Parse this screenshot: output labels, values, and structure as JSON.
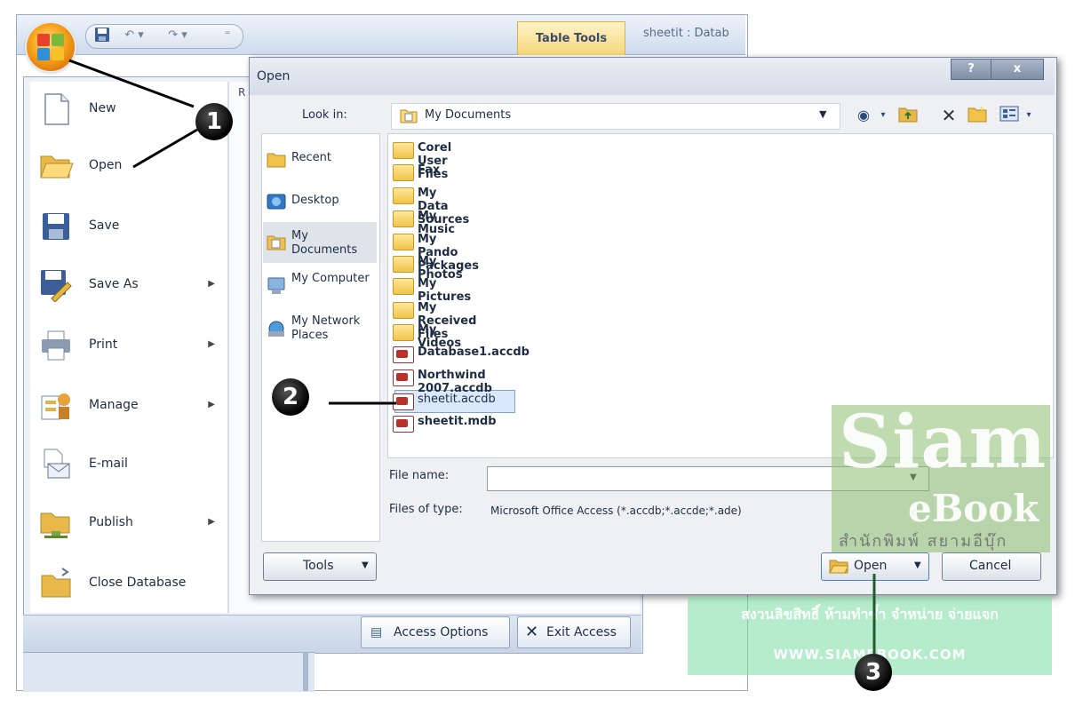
{
  "app": {
    "table_tools": "Table Tools",
    "title": "sheetit : Datab",
    "colors": {
      "ribbon": "#dbe5f2",
      "office_orange": "#f7a21a",
      "selection": "#dbe8fb"
    }
  },
  "qat": {
    "icons": [
      "save-icon",
      "undo-icon",
      "redo-icon",
      "customize-icon"
    ]
  },
  "menu": {
    "recent_header": "R",
    "items": [
      {
        "label": "New",
        "icon": "new-document-icon",
        "submenu": false
      },
      {
        "label": "Open",
        "icon": "open-folder-icon",
        "submenu": false
      },
      {
        "label": "Save",
        "icon": "save-disk-icon",
        "submenu": false
      },
      {
        "label": "Save As",
        "icon": "save-as-icon",
        "submenu": true
      },
      {
        "label": "Print",
        "icon": "printer-icon",
        "submenu": true
      },
      {
        "label": "Manage",
        "icon": "manage-icon",
        "submenu": true
      },
      {
        "label": "E-mail",
        "icon": "email-icon",
        "submenu": false
      },
      {
        "label": "Publish",
        "icon": "publish-icon",
        "submenu": true
      },
      {
        "label": "Close Database",
        "icon": "close-database-icon",
        "submenu": false
      }
    ],
    "access_options": "Access Options",
    "exit_access": "Exit Access"
  },
  "dialog": {
    "title": "Open",
    "help": "?",
    "close": "x",
    "look_in_label": "Look in:",
    "look_in_value": "My Documents",
    "places": [
      "Recent",
      "Desktop",
      "My Documents",
      "My Computer",
      "My Network Places"
    ],
    "files": [
      {
        "name": "Corel User Files",
        "type": "folder"
      },
      {
        "name": "Fax",
        "type": "folder"
      },
      {
        "name": "My Data Sources",
        "type": "folder"
      },
      {
        "name": "My Music",
        "type": "folder"
      },
      {
        "name": "My Pando Packages",
        "type": "folder"
      },
      {
        "name": "My Photos",
        "type": "folder"
      },
      {
        "name": "My Pictures",
        "type": "folder"
      },
      {
        "name": "My Received Files",
        "type": "folder"
      },
      {
        "name": "My Videos",
        "type": "folder"
      },
      {
        "name": "Database1.accdb",
        "type": "db"
      },
      {
        "name": "Northwind 2007.accdb",
        "type": "db"
      },
      {
        "name": "sheetit.accdb",
        "type": "db",
        "selected": true
      },
      {
        "name": "sheetit.mdb",
        "type": "db"
      }
    ],
    "file_name_label": "File name:",
    "file_name_value": "",
    "files_of_type_label": "Files of type:",
    "files_of_type_value": "Microsoft Office Access (*.accdb;*.accde;*.ade)",
    "tools": "Tools",
    "open": "Open",
    "cancel": "Cancel"
  },
  "watermark": {
    "siam": "Siam",
    "ebook": "eBook",
    "thai_name": "สำนักพิมพ์ สยามอีบุ๊ก",
    "rights": "สงวนลิขสิทธิ์ ห้ามทำซ้ำ จำหน่าย จ่ายแจก",
    "url": "WWW.SIAMEBOOK.COM"
  },
  "callouts": [
    "1",
    "2",
    "3"
  ]
}
